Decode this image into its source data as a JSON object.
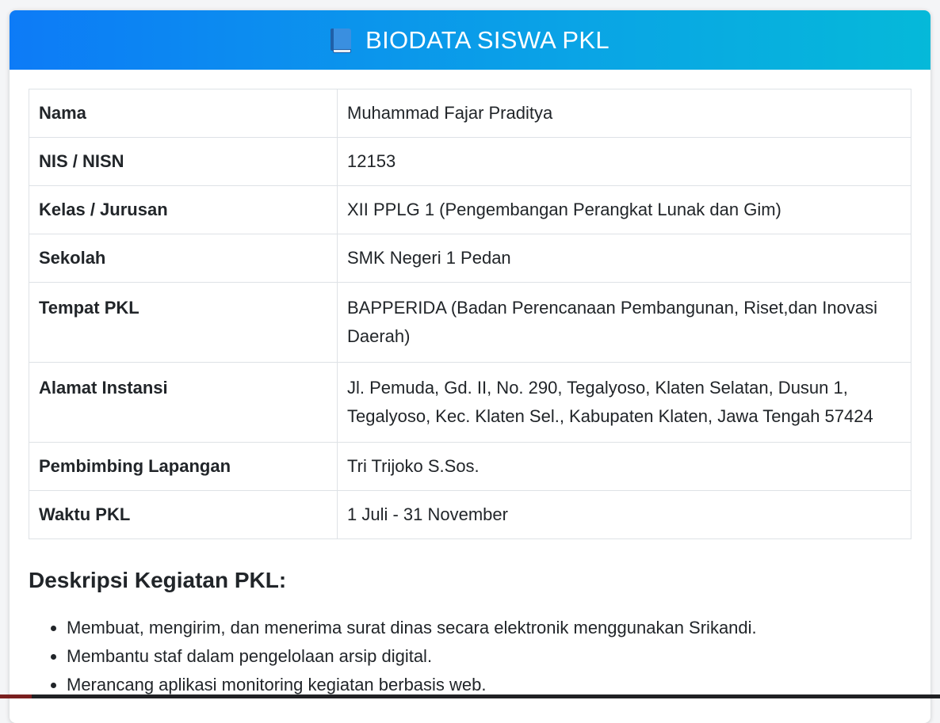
{
  "header": {
    "icon": "book-icon",
    "title": "BIODATA SISWA PKL",
    "gradient_start": "#0d7bf7",
    "gradient_end": "#05b9d9"
  },
  "biodata": [
    {
      "label": "Nama",
      "value": "Muhammad Fajar Praditya"
    },
    {
      "label": "NIS / NISN",
      "value": "12153"
    },
    {
      "label": "Kelas / Jurusan",
      "value": "XII PPLG 1 (Pengembangan Perangkat Lunak dan Gim)"
    },
    {
      "label": "Sekolah",
      "value": "SMK Negeri 1 Pedan"
    },
    {
      "label": "Tempat PKL",
      "value": "BAPPERIDA (Badan Perencanaan Pembangunan, Riset,dan Inovasi Daerah)"
    },
    {
      "label": "Alamat Instansi",
      "value": "Jl. Pemuda, Gd. II, No. 290, Tegalyoso, Klaten Selatan, Dusun 1, Tegalyoso, Kec. Klaten Sel., Kabupaten Klaten, Jawa Tengah 57424"
    },
    {
      "label": "Pembimbing Lapangan",
      "value": "Tri Trijoko S.Sos."
    },
    {
      "label": "Waktu PKL",
      "value": "1 Juli - 31 November"
    }
  ],
  "description": {
    "title": "Deskripsi Kegiatan PKL:",
    "items": [
      "Membuat, mengirim, dan menerima surat dinas secara elektronik menggunakan Srikandi.",
      "Membantu staf dalam pengelolaan arsip digital.",
      "Merancang aplikasi monitoring kegiatan berbasis web."
    ]
  }
}
